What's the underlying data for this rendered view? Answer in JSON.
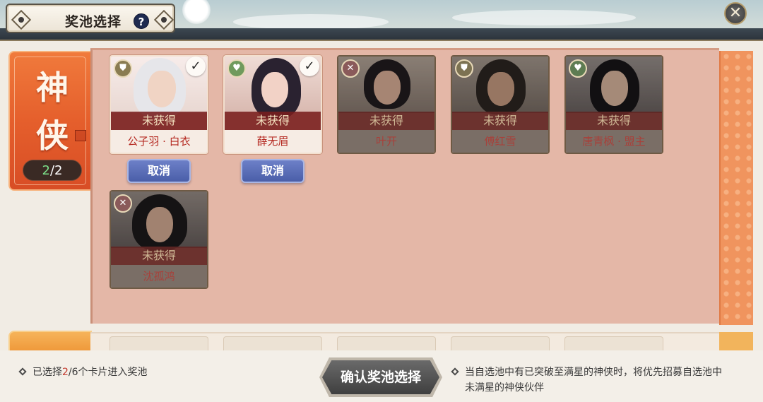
{
  "header": {
    "title": "奖池选择",
    "help_label": "?",
    "close_label": "✕"
  },
  "category": {
    "name_line1": "神",
    "name_line2": "侠",
    "count_selected": "2",
    "count_total": "/2"
  },
  "cards": [
    {
      "status": "未获得",
      "name": "公子羽 · 白衣",
      "role_icon": "shield-icon",
      "selected": true
    },
    {
      "status": "未获得",
      "name": "薛无眉",
      "role_icon": "heart-icon",
      "selected": true
    },
    {
      "status": "未获得",
      "name": "叶开",
      "role_icon": "crossed-swords-icon",
      "selected": false
    },
    {
      "status": "未获得",
      "name": "傅红雪",
      "role_icon": "shield-icon",
      "selected": false
    },
    {
      "status": "未获得",
      "name": "唐青枫 · 盟主",
      "role_icon": "heart-icon",
      "selected": false
    },
    {
      "status": "未获得",
      "name": "沈孤鸿",
      "role_icon": "crossed-swords-icon",
      "selected": false
    }
  ],
  "cancel_label": "取消",
  "footer": {
    "selected_prefix": "已选择",
    "selected_count": "2",
    "selected_suffix": "/6个卡片进入奖池",
    "confirm_label": "确认奖池选择",
    "note": "当自选池中有已突破至满星的神侠时，将优先招募自选池中未满星的神侠伙伴"
  },
  "colors": {
    "accent_orange": "#e55f2c",
    "panel_pink": "#e4b7a7",
    "status_red": "#782020",
    "cancel_blue": "#4a5ea8",
    "highlight_red": "#c23a2e",
    "count_green": "#7de08a"
  }
}
